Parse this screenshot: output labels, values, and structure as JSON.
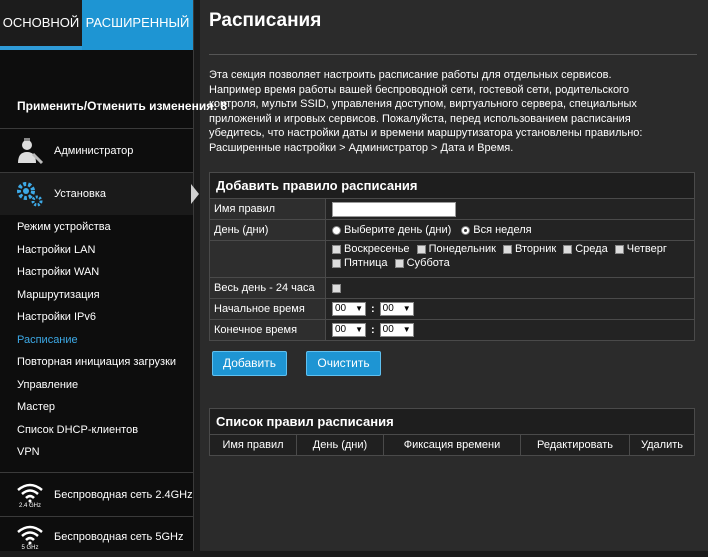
{
  "modes": {
    "basic": "ОСНОВНОЙ",
    "advanced": "РАСШИРЕННЫЙ"
  },
  "apply_label": "Применить/Отменить изменения: 8",
  "sections": {
    "admin": "Администратор",
    "setup": "Установка",
    "wifi24": "Беспроводная сеть 2.4GHz",
    "wifi24_badge": "2.4 GHz",
    "wifi5": "Беспроводная сеть 5GHz",
    "wifi5_badge": "5 GHz"
  },
  "nav": [
    "Режим устройства",
    "Настройки LAN",
    "Настройки WAN",
    "Маршрутизация",
    "Настройки IPv6",
    "Расписание",
    "Повторная инициация загрузки",
    "Управление",
    "Мастер",
    "Список DHCP-клиентов",
    "VPN"
  ],
  "page_title": "Расписания",
  "intro_lines": [
    "Эта секция позволяет настроить расписание работы для отдельных сервисов.",
    "Например время работы вашей беспроводной сети, гостевой сети, родительского",
    "контроля, мульти SSID, управления доступом, виртуального сервера, специальных",
    "приложений и игровых сервисов. Пожалуйста, перед использованием расписания",
    "убедитесь, что настройки даты и времени маршрутизатора установлены правильно:",
    "Расширенные настройки > Администратор > Дата и Время."
  ],
  "form": {
    "title": "Добавить правило расписания",
    "rule_name_label": "Имя правил",
    "rule_name_value": "",
    "days_label": "День (дни)",
    "radio_select": "Выберите день (дни)",
    "radio_week": "Вся неделя",
    "days": [
      "Воскресенье",
      "Понедельник",
      "Вторник",
      "Среда",
      "Четверг",
      "Пятница",
      "Суббота"
    ],
    "allday_label": "Весь день - 24 часа",
    "start_label": "Начальное время",
    "end_label": "Конечное время",
    "start_hour": "00",
    "start_min": "00",
    "end_hour": "00",
    "end_min": "00",
    "colon": ":"
  },
  "buttons": {
    "add": "Добавить",
    "clear": "Очистить"
  },
  "list": {
    "title": "Список правил расписания",
    "columns": [
      "Имя правил",
      "День (дни)",
      "Фиксация времени",
      "Редактировать",
      "Удалить"
    ]
  }
}
